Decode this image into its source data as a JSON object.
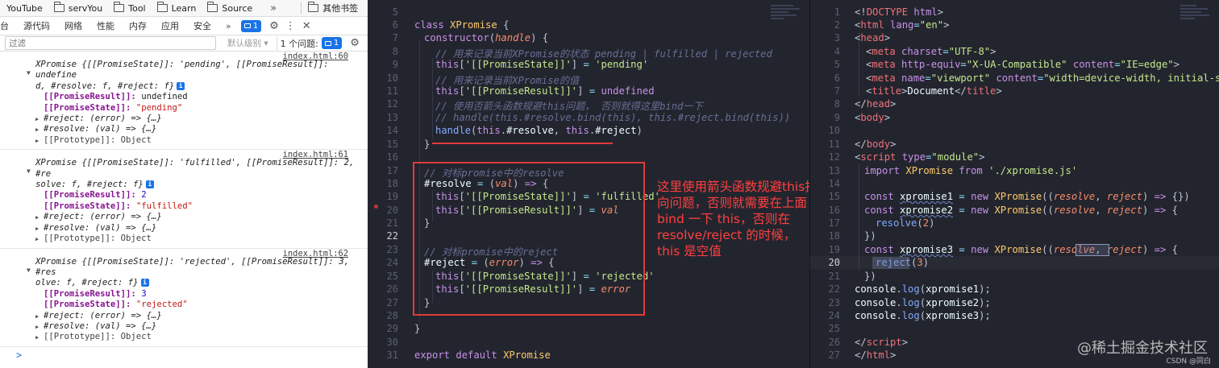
{
  "bookmarks": {
    "items": [
      {
        "label": "YouTube",
        "icon": "youtube-icon"
      },
      {
        "label": "servYou",
        "icon": "folder-icon"
      },
      {
        "label": "Tool",
        "icon": "folder-icon"
      },
      {
        "label": "Learn",
        "icon": "folder-icon"
      },
      {
        "label": "Source",
        "icon": "folder-icon"
      }
    ],
    "more": "»",
    "other": "其他书签"
  },
  "devtools": {
    "tabs": [
      "台",
      "源代码",
      "网络",
      "性能",
      "内存",
      "应用",
      "安全"
    ],
    "tab_more": "»",
    "issue_count": "1",
    "filter_placeholder": "过滤",
    "level": "默认级别 ▾",
    "issues_label": "1 个问题:",
    "issues_count": "1",
    "console": [
      {
        "source": "index.html:60",
        "head": "XPromise {[[PromiseState]]: 'pending', [[PromiseResult]]: undefined, #resolve: f, #reject: f}",
        "head_line1": "XPromise {[[PromiseState]]: 'pending', [[PromiseResult]]: undefine",
        "head_line2": "d, #resolve: f, #reject: f}",
        "result_key": "[[PromiseResult]]:",
        "result_val": "undefined",
        "state_key": "[[PromiseState]]:",
        "state_val": "\"pending\"",
        "reject": "#reject: (error) => {…}",
        "resolve": "#resolve: (val) => {…}",
        "proto": "[[Prototype]]: Object"
      },
      {
        "source": "index.html:61",
        "head_line1": "XPromise {[[PromiseState]]: 'fulfilled', [[PromiseResult]]: 2, #re",
        "head_line2": "solve: f, #reject: f}",
        "result_key": "[[PromiseResult]]:",
        "result_val": "2",
        "state_key": "[[PromiseState]]:",
        "state_val": "\"fulfilled\"",
        "reject": "#reject: (error) => {…}",
        "resolve": "#resolve: (val) => {…}",
        "proto": "[[Prototype]]: Object"
      },
      {
        "source": "index.html:62",
        "head_line1": "XPromise {[[PromiseState]]: 'rejected', [[PromiseResult]]: 3, #res",
        "head_line2": "olve: f, #reject: f}",
        "result_key": "[[PromiseResult]]:",
        "result_val": "3",
        "state_key": "[[PromiseState]]:",
        "state_val": "\"rejected\"",
        "reject": "#reject: (error) => {…}",
        "resolve": "#resolve: (val) => {…}",
        "proto": "[[Prototype]]: Object"
      }
    ],
    "prompt": ">"
  },
  "editor_left": {
    "line_numbers": [
      "5",
      "6",
      "7",
      "8",
      "9",
      "10",
      "11",
      "12",
      "13",
      "14",
      "15",
      "16",
      "17",
      "18",
      "19",
      "20",
      "21",
      "22",
      "23",
      "24",
      "25",
      "26",
      "27",
      "28",
      "29",
      "30",
      "31"
    ],
    "current_line": "22"
  },
  "editor_right": {
    "line_numbers": [
      "1",
      "2",
      "3",
      "4",
      "5",
      "6",
      "7",
      "8",
      "9",
      "10",
      "11",
      "12",
      "13",
      "14",
      "15",
      "16",
      "17",
      "18",
      "19",
      "20",
      "21",
      "22",
      "23",
      "24",
      "25",
      "26",
      "27"
    ],
    "current_line": "20"
  },
  "annotation": "这里使用箭头函数规避this指向问题，否则就需要在上面 bind 一下 this，否则在resolve/reject 的时候，this 是空值",
  "watermark": "@稀土掘金技术社区",
  "watermark_small": "CSDN @同白",
  "colors": {
    "annotation": "#ff4040",
    "accent": "#1a73e8"
  }
}
